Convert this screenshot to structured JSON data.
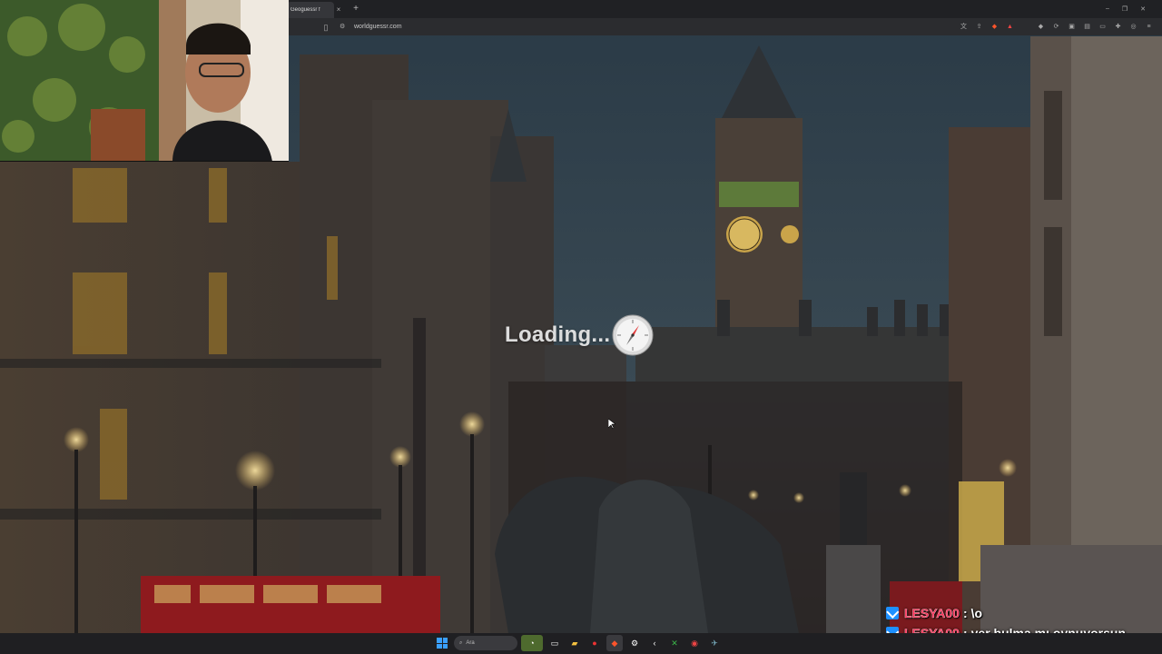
{
  "browser": {
    "tab_title": "Geoguessr f",
    "tab_close": "×",
    "new_tab": "+",
    "url": "worldguessr.com",
    "window_controls": [
      "–",
      "❐",
      "✕"
    ],
    "icons": [
      "translate-icon",
      "share-icon",
      "brave-shield-icon",
      "brave-rewards-icon",
      "extension-icon",
      "sync-icon",
      "screenshot-icon",
      "sidebar-icon",
      "wallet-icon",
      "puzzle-icon",
      "vpn-icon",
      "menu-icon"
    ]
  },
  "game": {
    "loading_text": "Loading..."
  },
  "chat": {
    "messages": [
      {
        "user": "LESYA00",
        "sep": ":",
        "text": "\\o"
      },
      {
        "user": "LESYA00",
        "sep": ":",
        "text": "yer bulma mı oynuyorsun"
      }
    ]
  },
  "taskbar": {
    "search_placeholder": "Ara",
    "colors": {
      "accent": "#3aa0ff",
      "chat_user": "#ff2d55"
    }
  }
}
